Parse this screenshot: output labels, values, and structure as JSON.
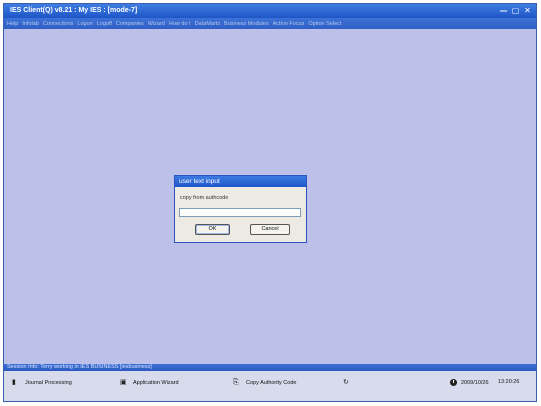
{
  "window": {
    "title": "IES Client(Q) v8.21 : My IES :        [mode-7]",
    "controls": [
      "—",
      "▢",
      "✕"
    ]
  },
  "menu": [
    "Help",
    "Infolab",
    "Connections",
    "Logon",
    "Logoff",
    "Companies",
    "Wizard",
    "How do I",
    "DataMarts",
    "Business Modules",
    "Action Focus",
    "Option Select"
  ],
  "dialog": {
    "title": "user text input",
    "label": "copy from authcode",
    "input_value": "",
    "ok_label": "OK",
    "cancel_label": "Cancel"
  },
  "session": {
    "text": "Session Info: Terry working in IES BUSINESS   [iesbusiness]"
  },
  "taskbar": {
    "items": [
      {
        "label": "Journal Processing",
        "icon": "journal-icon"
      },
      {
        "label": "Application Wizard",
        "icon": "wizard-icon"
      },
      {
        "label": "Copy Authority Code",
        "icon": "copy-authority-icon"
      },
      {
        "label": "",
        "icon": "refresh-icon"
      }
    ],
    "date": "2009/10/26",
    "time": "13:20:26"
  },
  "colors": {
    "title_bar": "#1e55c8",
    "workspace": "#bdc0e8",
    "dialog_bg": "#eceae2"
  }
}
